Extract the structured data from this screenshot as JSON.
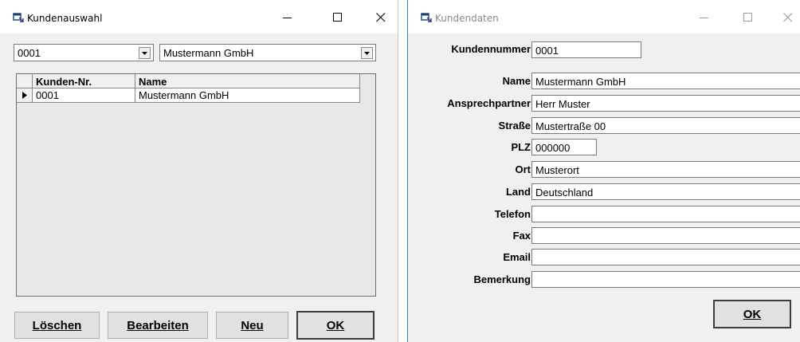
{
  "kundenauswahl": {
    "title": "Kundenauswahl",
    "selected_number": "0001",
    "selected_name": "Mustermann GmbH",
    "table": {
      "columns": [
        "Kunden-Nr.",
        "Name"
      ],
      "rows": [
        [
          "0001",
          "Mustermann GmbH"
        ]
      ]
    },
    "buttons": {
      "delete": "Löschen",
      "edit": "Bearbeiten",
      "new": "Neu",
      "ok": "OK"
    }
  },
  "kundendaten": {
    "title": "Kundendaten",
    "fields": [
      {
        "label": "Kundennummer",
        "value": "0001"
      },
      {
        "label": "Name",
        "value": "Mustermann GmbH"
      },
      {
        "label": "Ansprechpartner",
        "value": "Herr Muster"
      },
      {
        "label": "Straße",
        "value": "Mustertraße 00"
      },
      {
        "label": "PLZ",
        "value": "000000"
      },
      {
        "label": "Ort",
        "value": "Musterort"
      },
      {
        "label": "Land",
        "value": "Deutschland"
      },
      {
        "label": "Telefon",
        "value": ""
      },
      {
        "label": "Fax",
        "value": ""
      },
      {
        "label": "Email",
        "value": ""
      },
      {
        "label": "Bemerkung",
        "value": ""
      }
    ],
    "ok_label": "OK"
  },
  "icons": {
    "app": "window-app-icon",
    "minimize": "minimize-icon",
    "maximize": "maximize-icon",
    "close": "close-icon",
    "dropdown": "dropdown-arrow-icon",
    "row_pointer": "row-pointer-icon"
  }
}
